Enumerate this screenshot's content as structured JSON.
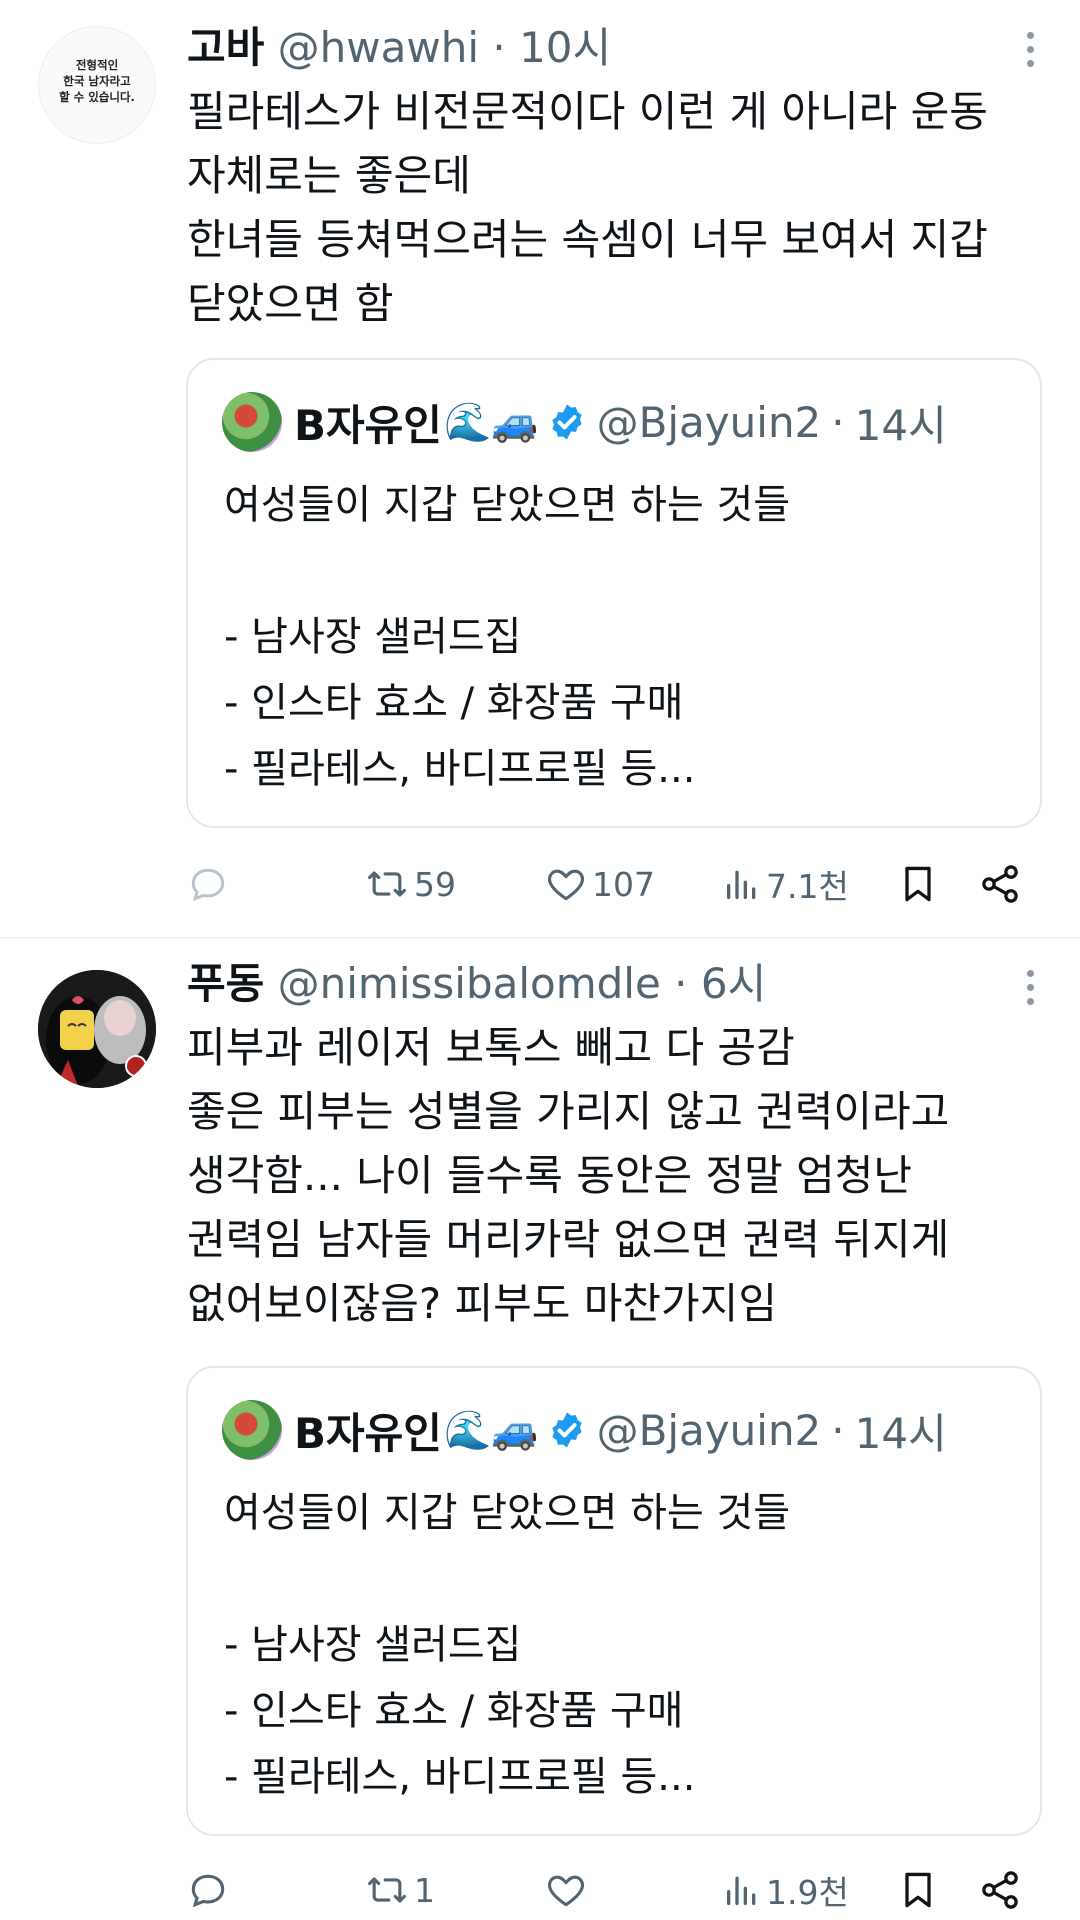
{
  "tweets": [
    {
      "avatar_text": "전형적인\n한국 남자라고\n할 수 있습니다.",
      "name": "고바",
      "handle": "@hwawhi",
      "dot": "·",
      "time": "10시",
      "body": [
        "필라테스가 비전문적이다 이런 게 아니라 운동",
        "자체로는 좋은데",
        "한녀들 등쳐먹으려는 속셈이 너무 보여서 지갑",
        "닫았으면 함"
      ],
      "quote": {
        "name": "B자유인",
        "emoji": "🌊🚙",
        "handle": "@Bjayuin2",
        "dot": "·",
        "time": "14시",
        "body": [
          "여성들이 지갑 닫았으면 하는 것들",
          "",
          "- 남사장 샐러드집",
          "- 인스타 효소 / 화장품 구매",
          "- 필라테스, 바디프로필 등..."
        ]
      },
      "actions": {
        "reply": "",
        "retweets": "59",
        "likes": "107",
        "views": "7.1천"
      }
    },
    {
      "avatar_text": "",
      "name": "푸동",
      "handle": "@nimissibalomdle",
      "dot": "·",
      "time": "6시",
      "body": [
        "피부과 레이저 보톡스 빼고 다 공감",
        "좋은 피부는 성별을 가리지 않고 권력이라고",
        "생각함... 나이 들수록 동안은 정말 엄청난",
        "권력임 남자들 머리카락 없으면 권력 뒤지게",
        "없어보이잖음? 피부도 마찬가지임"
      ],
      "quote": {
        "name": "B자유인",
        "emoji": "🌊🚙",
        "handle": "@Bjayuin2",
        "dot": "·",
        "time": "14시",
        "body": [
          "여성들이 지갑 닫았으면 하는 것들",
          "",
          "- 남사장 샐러드집",
          "- 인스타 효소 / 화장품 구매",
          "- 필라테스, 바디프로필 등..."
        ]
      },
      "actions": {
        "reply": "",
        "retweets": "1",
        "likes": "",
        "views": "1.9천"
      }
    }
  ],
  "icons": {
    "reply": "reply-icon",
    "retweet": "retweet-icon",
    "like": "heart-icon",
    "views": "views-icon",
    "bookmark": "bookmark-icon",
    "share": "share-icon",
    "more": "more-icon",
    "verified": "verified-badge-icon"
  },
  "colors": {
    "text": "#0f1419",
    "muted": "#536471",
    "verified": "#1d9bf0",
    "border": "#e1e8ed"
  }
}
